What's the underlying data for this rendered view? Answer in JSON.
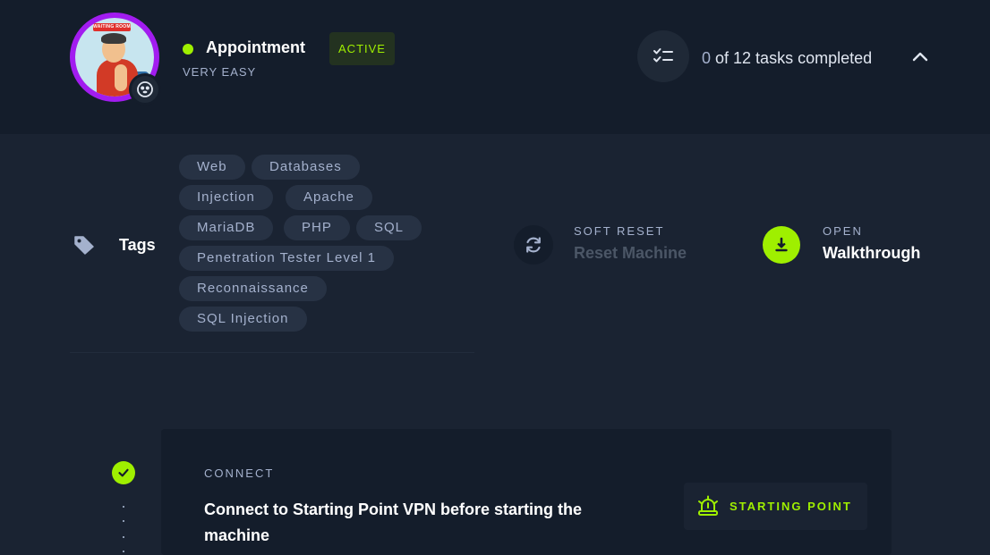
{
  "colors": {
    "accent_green": "#9fef00",
    "avatar_ring": "#a21cf0",
    "background": "#1a2332",
    "panel": "#141d2b",
    "chip_bg": "#273244",
    "muted_text": "#a4b1cd"
  },
  "machine": {
    "name": "Appointment",
    "difficulty": "VERY EASY",
    "status_badge": "ACTIVE",
    "avatar_sign": "WAITING ROOM",
    "avatar_icon": "machine-avatar-cartoon",
    "os_icon": "linux-penguin-icon"
  },
  "tasks": {
    "completed": "0",
    "summary_rest": " of 12 tasks completed",
    "icon": "checklist-icon",
    "toggle_icon": "chevron-up-icon"
  },
  "tags": {
    "label": "Tags",
    "icon": "tag-icon",
    "items": [
      "Web",
      "Databases",
      "Injection",
      "Apache",
      "MariaDB",
      "PHP",
      "SQL",
      "Penetration Tester Level 1",
      "Reconnaissance",
      "SQL Injection"
    ]
  },
  "reset": {
    "label": "SOFT RESET",
    "action": "Reset Machine",
    "icon": "refresh-icon"
  },
  "walkthrough": {
    "label": "OPEN",
    "action": "Walkthrough",
    "icon": "download-icon"
  },
  "task_card": {
    "label": "CONNECT",
    "title": "Connect to Starting Point VPN before starting the machine",
    "badge": "STARTING POINT",
    "badge_icon": "starting-point-bell-icon",
    "status_icon": "check-icon"
  }
}
